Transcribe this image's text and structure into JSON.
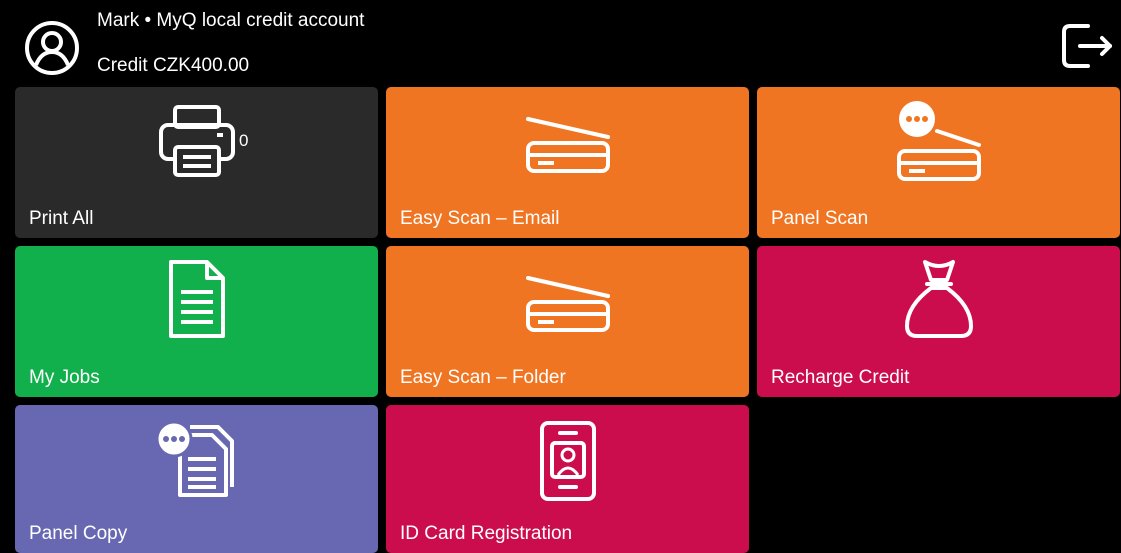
{
  "header": {
    "user_account": "Mark • MyQ local credit account",
    "credit": "Credit CZK400.00",
    "avatar_icon": "user-circle-icon",
    "logout_icon": "logout-icon"
  },
  "tiles": [
    {
      "label": "Print All",
      "icon": "printer-icon",
      "color": "#2a2a2a",
      "badge": "0"
    },
    {
      "label": "Easy Scan – Email",
      "icon": "scanner-icon",
      "color": "#f07522"
    },
    {
      "label": "Panel Scan",
      "icon": "scanner-chat-icon",
      "color": "#f07522"
    },
    {
      "label": "My Jobs",
      "icon": "document-icon",
      "color": "#12b04c"
    },
    {
      "label": "Easy Scan – Folder",
      "icon": "scanner-icon",
      "color": "#f07522"
    },
    {
      "label": "Recharge Credit",
      "icon": "money-bag-icon",
      "color": "#cc0d4d"
    },
    {
      "label": "Panel Copy",
      "icon": "copy-chat-icon",
      "color": "#6868b2"
    },
    {
      "label": "ID Card Registration",
      "icon": "id-card-icon",
      "color": "#cc0d4d"
    }
  ]
}
